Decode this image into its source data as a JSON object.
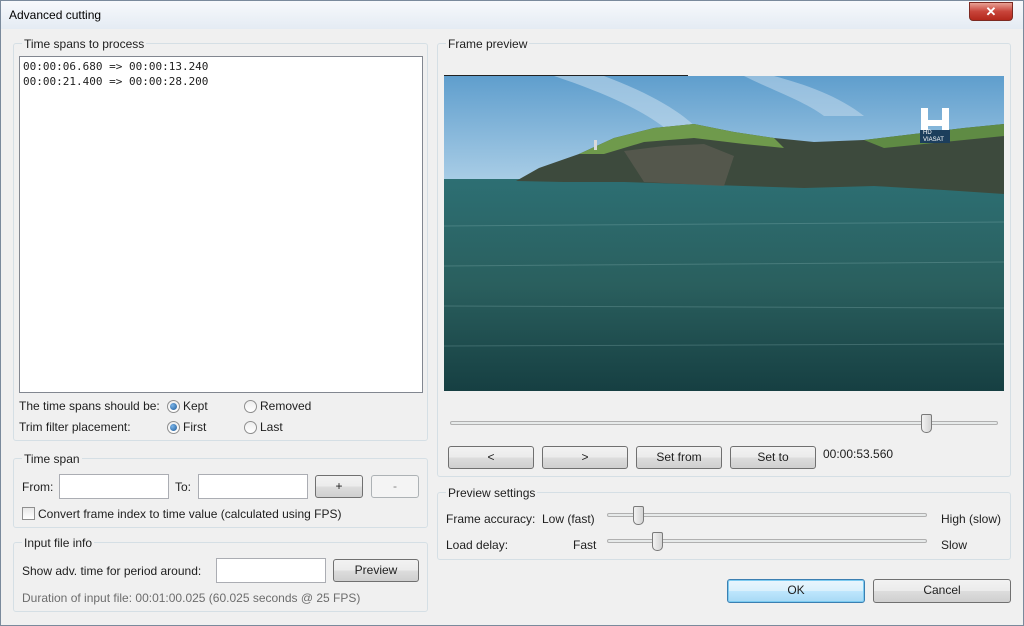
{
  "window": {
    "title": "Advanced cutting",
    "close_symbol": "✕"
  },
  "time_spans": {
    "group_label": "Time spans to process",
    "items": [
      "00:00:06.680 => 00:00:13.240",
      "00:00:21.400 => 00:00:28.200"
    ],
    "kept_label": "The time spans should be:",
    "kept_options": [
      "Kept",
      "Removed"
    ],
    "kept_selected": "Kept",
    "trim_label": "Trim filter placement:",
    "trim_options": [
      "First",
      "Last"
    ],
    "trim_selected": "First"
  },
  "time_span": {
    "group_label": "Time span",
    "from_label": "From:",
    "from_value": "",
    "to_label": "To:",
    "to_value": "",
    "add_label": "+",
    "remove_label": "-",
    "convert_label": "Convert frame index to time value (calculated using FPS)",
    "convert_checked": false
  },
  "input_file": {
    "group_label": "Input file info",
    "show_label": "Show adv. time for period around:",
    "show_value": "",
    "preview_button": "Preview",
    "duration_text": "Duration of input file: 00:01:00.025 (60.025 seconds @ 25 FPS)"
  },
  "frame_preview": {
    "group_label": "Frame preview",
    "logo_text": "VIASAT",
    "logo_hd": "HD",
    "position_fraction": 0.87,
    "prev_label": "<",
    "next_label": ">",
    "set_from_label": "Set from",
    "set_to_label": "Set to",
    "time_display": "00:00:53.560"
  },
  "preview_settings": {
    "group_label": "Preview settings",
    "accuracy_label": "Frame accuracy:",
    "accuracy_low": "Low (fast)",
    "accuracy_high": "High (slow)",
    "accuracy_fraction": 0.1,
    "delay_label": "Load delay:",
    "delay_fast": "Fast",
    "delay_slow": "Slow",
    "delay_fraction": 0.16
  },
  "footer": {
    "ok_label": "OK",
    "cancel_label": "Cancel"
  }
}
